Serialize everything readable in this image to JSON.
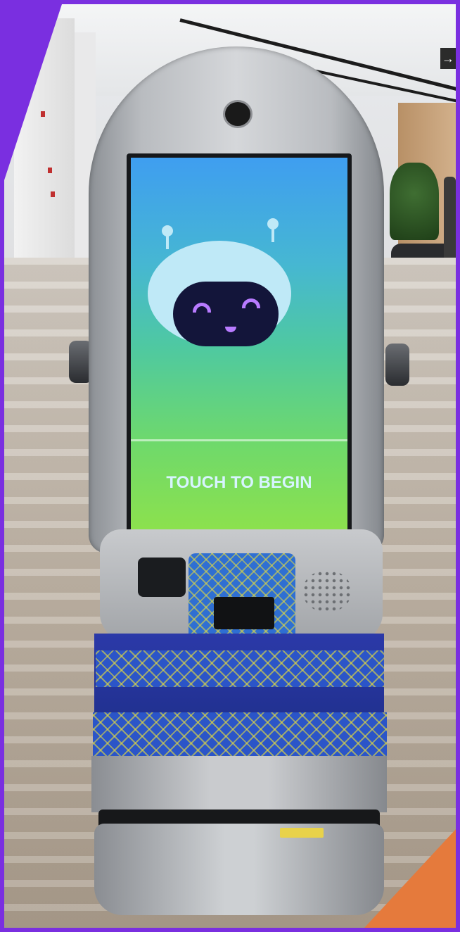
{
  "kiosk": {
    "screen": {
      "prompt": "TOUCH TO BEGIN",
      "mascot": "robot-face-icon"
    },
    "colors": {
      "frame_border": "#7a2fe0",
      "corner_accent": "#e57a3c",
      "screen_top": "#3f9ef0",
      "screen_bottom": "#8fe24a",
      "body_band": "#2b39a8",
      "mascot_eye": "#b87bff"
    }
  },
  "background": {
    "sign_glyph": "→"
  }
}
